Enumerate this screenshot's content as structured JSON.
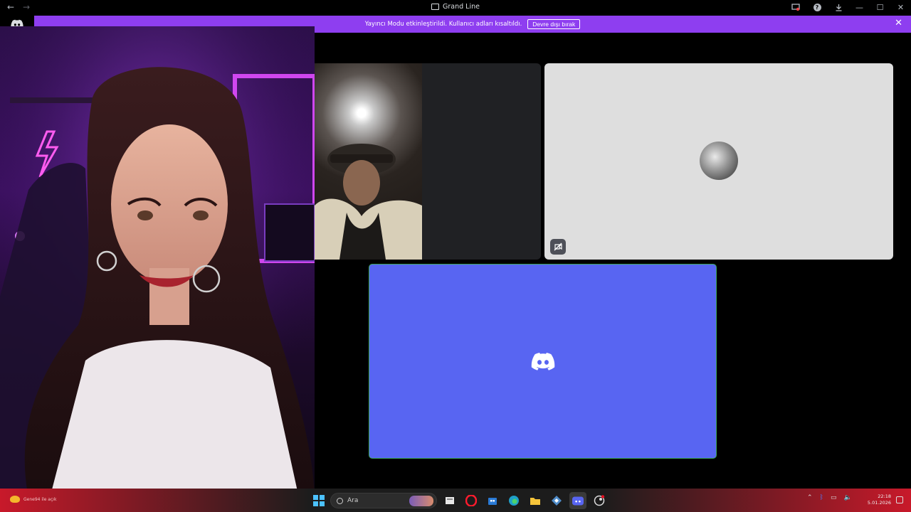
{
  "window": {
    "title": "Grand Line",
    "back_label": "←",
    "forward_label": "→",
    "minimize_label": "—",
    "maximize_label": "☐",
    "close_label": "✕"
  },
  "banner": {
    "message": "Yayıncı Modu etkinleştirildi. Kullanıcı adları kısaltıldı.",
    "disable_button": "Devre dışı bırak",
    "close_label": "✕",
    "color": "#8e3ef0"
  },
  "call": {
    "accent": "#5865f2",
    "speaking_border": "#3ba55d",
    "tiles": [
      {
        "type": "video"
      },
      {
        "type": "avatar",
        "muted_video": true
      },
      {
        "type": "discord-logo"
      }
    ]
  },
  "taskbar": {
    "weather_text": "Gene94 ile açık",
    "search_placeholder": "Ara",
    "time": "22:18",
    "date": "5.01.2026",
    "apps": [
      "notes-icon",
      "opera-icon",
      "store-icon",
      "edge-icon",
      "file-explorer-icon",
      "app-icon",
      "discord-icon",
      "steam-icon"
    ]
  }
}
